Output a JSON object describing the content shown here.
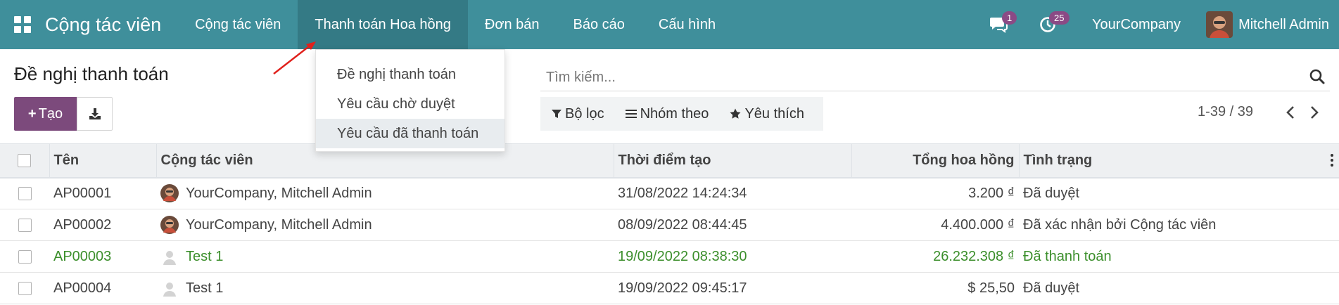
{
  "navbar": {
    "app_title": "Cộng tác viên",
    "menu": [
      {
        "label": "Cộng tác viên"
      },
      {
        "label": "Thanh toán Hoa hồng"
      },
      {
        "label": "Đơn bán"
      },
      {
        "label": "Báo cáo"
      },
      {
        "label": "Cấu hình"
      }
    ],
    "messages_count": "1",
    "activities_count": "25",
    "company": "YourCompany",
    "user_name": "Mitchell Admin",
    "color": "#3f8f9b"
  },
  "dropdown": {
    "items": [
      {
        "label": "Đề nghị thanh toán"
      },
      {
        "label": "Yêu cầu chờ duyệt"
      },
      {
        "label": "Yêu cầu đã thanh toán"
      }
    ]
  },
  "control": {
    "page_title": "Đề nghị thanh toán",
    "create_label": "Tạo",
    "search_placeholder": "Tìm kiếm...",
    "filter_label": "Bộ lọc",
    "group_label": "Nhóm theo",
    "favorite_label": "Yêu thích",
    "pager": "1-39 / 39",
    "create_color": "#7c4a7c"
  },
  "table": {
    "headers": {
      "name": "Tên",
      "partner": "Cộng tác viên",
      "created": "Thời điểm tạo",
      "total": "Tổng hoa hồng",
      "state": "Tình trạng"
    },
    "rows": [
      {
        "name": "AP00001",
        "partner": "YourCompany, Mitchell Admin",
        "created": "31/08/2022 14:24:34",
        "total": "3.200 ₫",
        "state": "Đã duyệt"
      },
      {
        "name": "AP00002",
        "partner": "YourCompany, Mitchell Admin",
        "created": "08/09/2022 08:44:45",
        "total": "4.400.000 ₫",
        "state": "Đã xác nhận bởi Cộng tác viên"
      },
      {
        "name": "AP00003",
        "partner": "Test 1",
        "created": "19/09/2022 08:38:30",
        "total": "26.232.308 ₫",
        "state": "Đã thanh toán"
      },
      {
        "name": "AP00004",
        "partner": "Test 1",
        "created": "19/09/2022 09:45:17",
        "total": "$ 25,50",
        "state": "Đã duyệt"
      }
    ],
    "paid_color": "#3c8f2c"
  }
}
